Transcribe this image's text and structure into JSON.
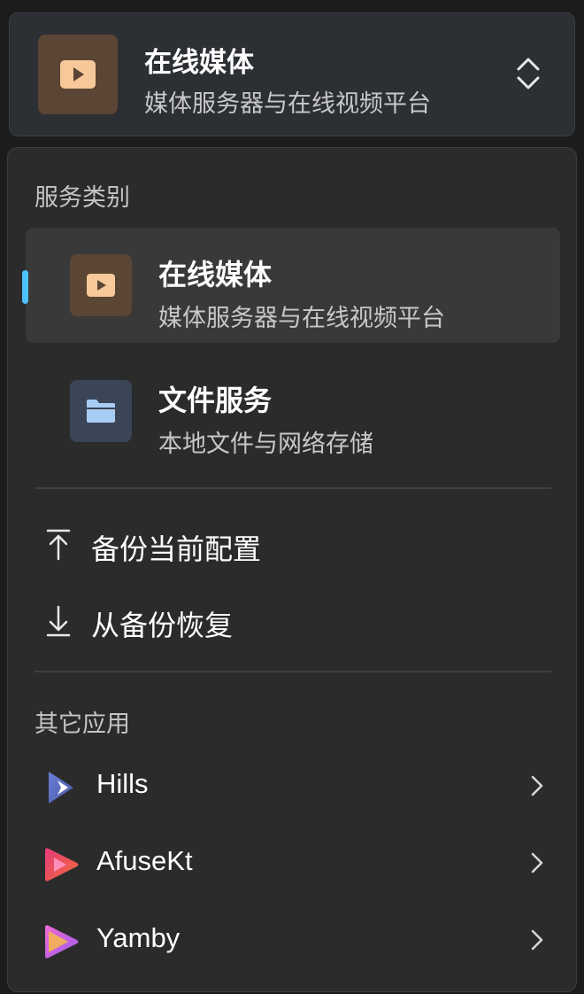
{
  "selector": {
    "title": "在线媒体",
    "subtitle": "媒体服务器与在线视频平台",
    "icon": "play-icon",
    "expand_icon": "up-down-chevron-icon"
  },
  "menu": {
    "categories_label": "服务类别",
    "categories": [
      {
        "title": "在线媒体",
        "subtitle": "媒体服务器与在线视频平台",
        "icon": "play-icon",
        "selected": true
      },
      {
        "title": "文件服务",
        "subtitle": "本地文件与网络存储",
        "icon": "folder-icon",
        "selected": false
      }
    ],
    "actions": [
      {
        "label": "备份当前配置",
        "icon": "upload-arrow-icon"
      },
      {
        "label": "从备份恢复",
        "icon": "download-arrow-icon"
      }
    ],
    "other_apps_label": "其它应用",
    "apps": [
      {
        "name": "Hills",
        "icon": "hills-logo-icon"
      },
      {
        "name": "AfuseKt",
        "icon": "afusekt-logo-icon"
      },
      {
        "name": "Yamby",
        "icon": "yamby-logo-icon"
      }
    ]
  },
  "colors": {
    "accent": "#4cc2ff",
    "media_tile": "#5b4534",
    "files_tile": "#3a4558",
    "play_glyph": "#f7c99a",
    "folder_glyph": "#a8cdf5"
  }
}
